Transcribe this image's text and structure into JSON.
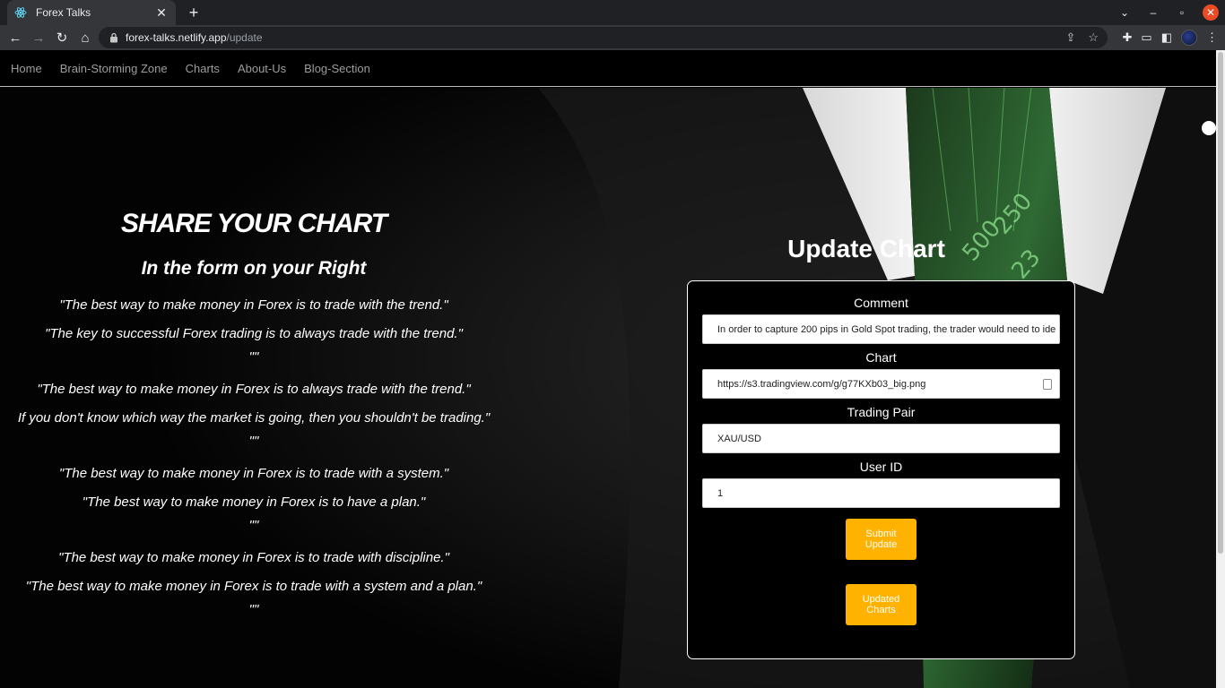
{
  "browser": {
    "tab_title": "Forex Talks",
    "url_host": "forex-talks.netlify.app",
    "url_path": "/update"
  },
  "site_nav": {
    "items": [
      "Home",
      "Brain-Storming Zone",
      "Charts",
      "About-Us",
      "Blog-Section"
    ]
  },
  "left": {
    "title": "SHARE YOUR CHART",
    "subtitle": "In the form on your Right",
    "quotes": [
      "\"The best way to make money in Forex is to trade with the trend.\"",
      "\"The key to successful Forex trading is to always trade with the trend.\"",
      "\"\"",
      "\"The best way to make money in Forex is to always trade with the trend.\"",
      "If you don't know which way the market is going, then you shouldn't be trading.\"",
      "\"\"",
      "\"The best way to make money in Forex is to trade with a system.\"",
      "\"The best way to make money in Forex is to have a plan.\"",
      "\"\"",
      "\"The best way to make money in Forex is to trade with discipline.\"",
      "\"The best way to make money in Forex is to trade with a system and a plan.\"",
      "\"\""
    ]
  },
  "form": {
    "heading": "Update Chart",
    "comment_label": "Comment",
    "comment_value": "In order to capture 200 pips in Gold Spot trading, the trader would need to ide",
    "chart_label": "Chart",
    "chart_value": "https://s3.tradingview.com/g/g77KXb03_big.png",
    "pair_label": "Trading Pair",
    "pair_value": "XAU/USD",
    "user_label": "User ID",
    "user_value": "1",
    "submit_label": "Submit Update",
    "updated_label": "Updated Charts"
  },
  "colors": {
    "accent": "#ffb300",
    "card_border": "#ffffff"
  }
}
